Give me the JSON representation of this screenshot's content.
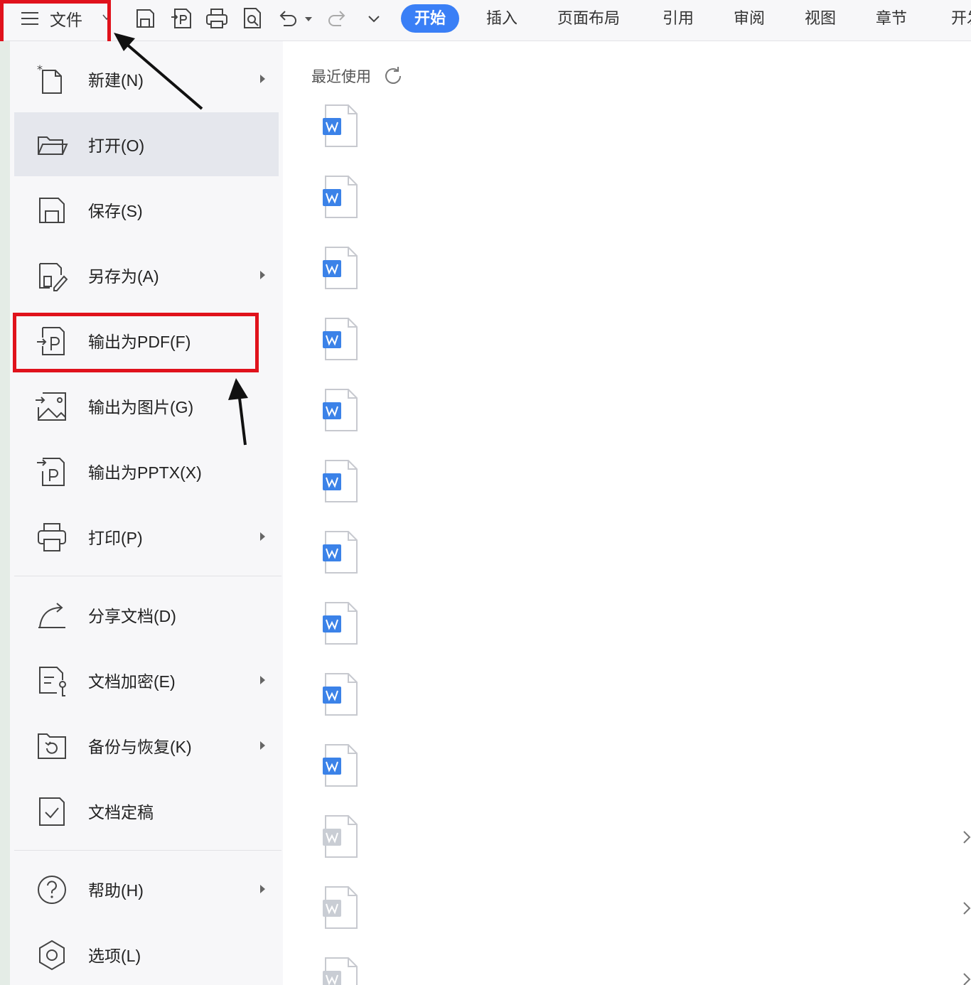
{
  "toolbar": {
    "file_label": "文件",
    "tabs": [
      {
        "label": "开始",
        "active": true
      },
      {
        "label": "插入"
      },
      {
        "label": "页面布局"
      },
      {
        "label": "引用"
      },
      {
        "label": "审阅"
      },
      {
        "label": "视图"
      },
      {
        "label": "章节"
      },
      {
        "label": "开发"
      }
    ],
    "quick_icons": [
      "save-icon",
      "export-pdf-icon",
      "print-icon",
      "print-preview-icon",
      "undo-icon",
      "undo-dropdown-icon",
      "redo-icon",
      "customize-dropdown-icon"
    ]
  },
  "menu": {
    "items": [
      {
        "label": "新建(N)",
        "icon": "new-file-icon",
        "submenu": true
      },
      {
        "label": "打开(O)",
        "icon": "folder-open-icon",
        "selected": true
      },
      {
        "label": "保存(S)",
        "icon": "save-icon"
      },
      {
        "label": "另存为(A)",
        "icon": "save-as-icon",
        "submenu": true
      },
      {
        "label": "输出为PDF(F)",
        "icon": "export-pdf-icon",
        "highlighted": true
      },
      {
        "label": "输出为图片(G)",
        "icon": "export-image-icon"
      },
      {
        "label": "输出为PPTX(X)",
        "icon": "export-pptx-icon"
      },
      {
        "label": "打印(P)",
        "icon": "print-icon",
        "submenu": true
      },
      {
        "label": "分享文档(D)",
        "icon": "share-icon"
      },
      {
        "label": "文档加密(E)",
        "icon": "encrypt-icon",
        "submenu": true
      },
      {
        "label": "备份与恢复(K)",
        "icon": "backup-icon",
        "submenu": true
      },
      {
        "label": "文档定稿",
        "icon": "finalize-icon"
      },
      {
        "label": "帮助(H)",
        "icon": "help-icon",
        "submenu": true
      },
      {
        "label": "选项(L)",
        "icon": "options-gear-icon"
      }
    ]
  },
  "recent": {
    "heading": "最近使用",
    "file_icon": "word-doc-icon"
  },
  "colors": {
    "accent": "#3a7ff6",
    "annotation_red": "#e0121c",
    "word_blue": "#3b82e8"
  }
}
